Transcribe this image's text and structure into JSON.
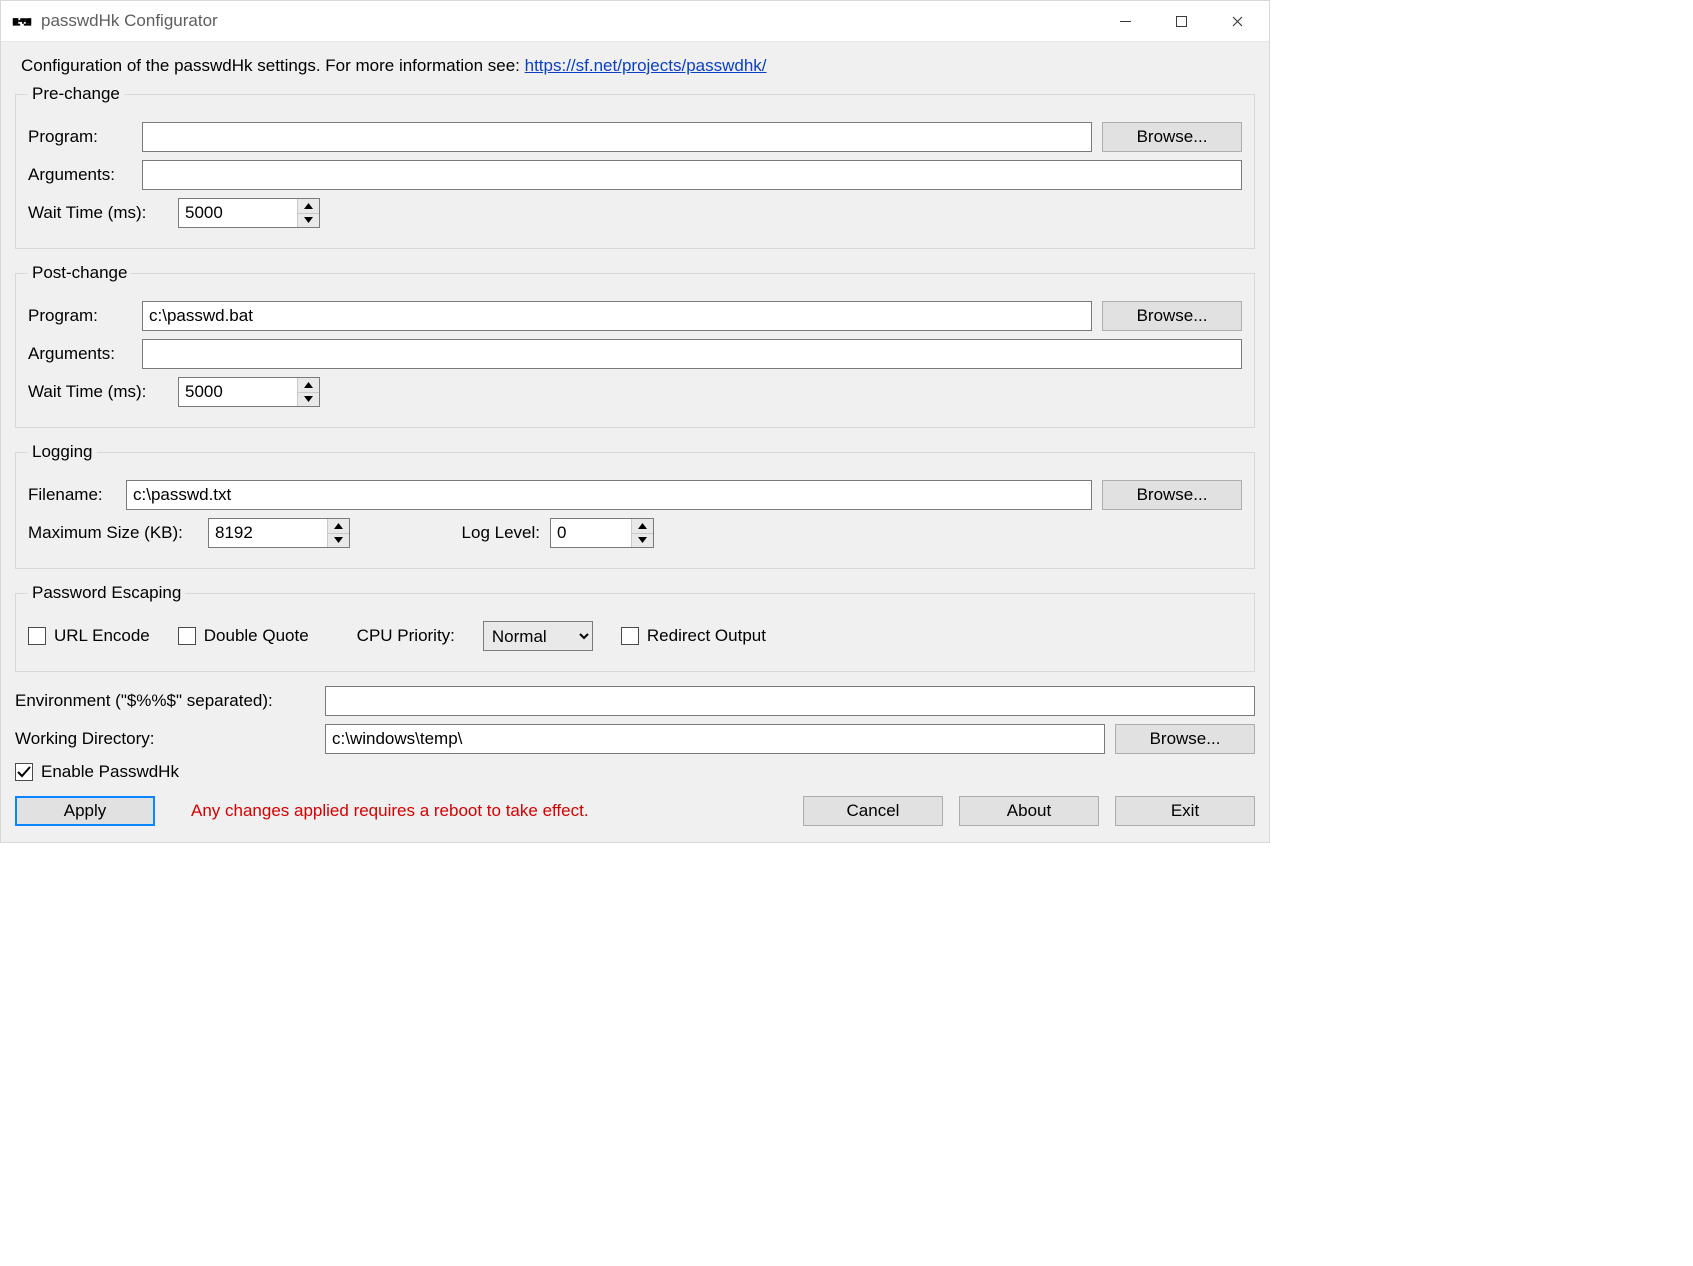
{
  "window": {
    "title": "passwdHk Configurator"
  },
  "intro": {
    "text": "Configuration of the passwdHk settings.  For more information see:   ",
    "link": "https://sf.net/projects/passwdhk/"
  },
  "pre": {
    "legend": "Pre-change",
    "program_label": "Program:",
    "program_value": "",
    "args_label": "Arguments:",
    "args_value": "",
    "wait_label": "Wait Time (ms):",
    "wait_value": "5000",
    "browse": "Browse..."
  },
  "post": {
    "legend": "Post-change",
    "program_label": "Program:",
    "program_value": "c:\\passwd.bat",
    "args_label": "Arguments:",
    "args_value": "",
    "wait_label": "Wait Time (ms):",
    "wait_value": "5000",
    "browse": "Browse..."
  },
  "log": {
    "legend": "Logging",
    "filename_label": "Filename:",
    "filename_value": "c:\\passwd.txt",
    "maxsize_label": "Maximum Size (KB):",
    "maxsize_value": "8192",
    "loglevel_label": "Log Level:",
    "loglevel_value": "0",
    "browse": "Browse..."
  },
  "escape": {
    "legend": "Password Escaping",
    "urlencode_label": "URL Encode",
    "dquote_label": "Double Quote",
    "cpu_label": "CPU Priority:",
    "cpu_value": "Normal",
    "redirect_label": "Redirect Output"
  },
  "env": {
    "label": "Environment (\"$%%$\" separated):",
    "value": ""
  },
  "wd": {
    "label": "Working Directory:",
    "value": "c:\\windows\\temp\\",
    "browse": "Browse..."
  },
  "enable": {
    "label": "Enable PasswdHk",
    "checked": true
  },
  "footer": {
    "apply": "Apply",
    "warn": "Any changes applied requires a reboot to take effect.",
    "cancel": "Cancel",
    "about": "About",
    "exit": "Exit"
  }
}
